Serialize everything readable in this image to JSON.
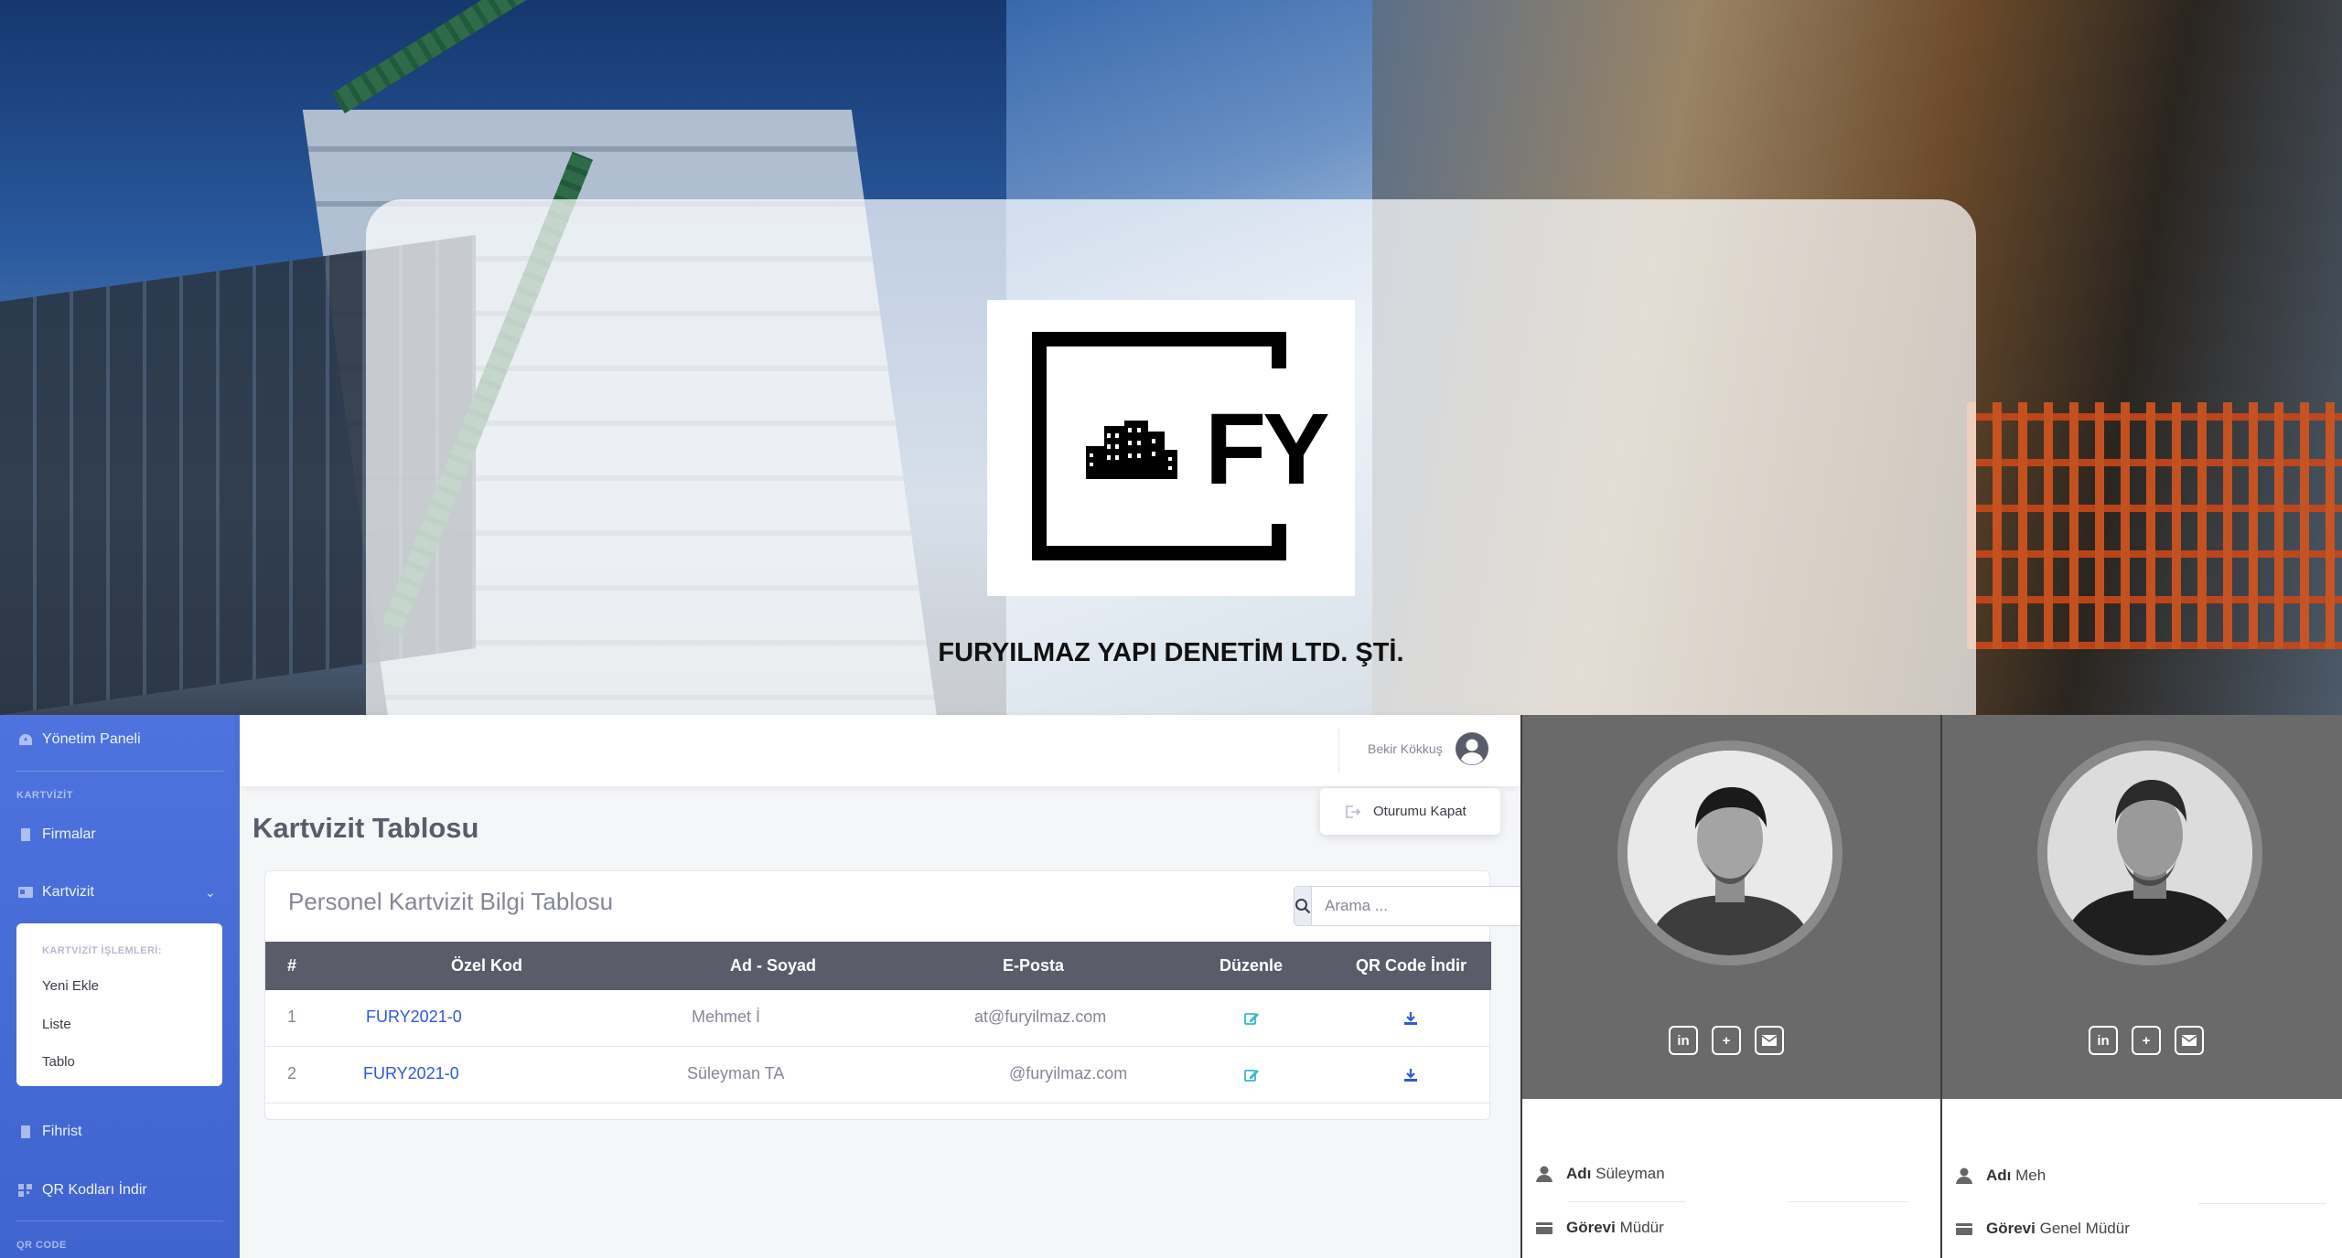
{
  "hero": {
    "logo_text": "FY",
    "company_name": "FURYILMAZ YAPI DENETİM LTD. ŞTİ."
  },
  "sidebar": {
    "dashboard": "Yönetim Paneli",
    "section_kartvizit": "KARTVİZİT",
    "firmalar": "Firmalar",
    "kartvizit": "Kartvizit",
    "submenu": {
      "header": "KARTVİZİT İŞLEMLERİ:",
      "items": [
        "Yeni Ekle",
        "Liste",
        "Tablo"
      ]
    },
    "fihrist": "Fihrist",
    "qr_download": "QR Kodları İndir",
    "section_qr": "QR CODE"
  },
  "topbar": {
    "user_name": "Bekir Kökkuş",
    "logout_label": "Oturumu Kapat"
  },
  "page": {
    "title": "Kartvizit Tablosu"
  },
  "table_card": {
    "title": "Personel Kartvizit Bilgi Tablosu",
    "search_placeholder": "Arama ...",
    "columns": [
      "#",
      "Özel Kod",
      "Ad - Soyad",
      "E-Posta",
      "Düzenle",
      "QR Code İndir"
    ],
    "rows": [
      {
        "index": "1",
        "code": "FURY2021-0",
        "name": "Mehmet İ",
        "email": "at@furyilmaz.com"
      },
      {
        "index": "2",
        "code": "FURY2021-0",
        "name": "Süleyman TA",
        "email": "@furyilmaz.com"
      }
    ]
  },
  "profiles": [
    {
      "name_label": "Adı",
      "name_value": "Süleyman ",
      "role_label": "Görevi",
      "role_value": "Müdür"
    },
    {
      "name_label": "Adı",
      "name_value": "Meh",
      "role_label": "Görevi",
      "role_value": "Genel Müdür"
    }
  ],
  "social": {
    "linkedin": "in",
    "add": "+"
  },
  "colors": {
    "sidebar": "#4e73df",
    "table_header": "#5a5c69",
    "link": "#2e59d9",
    "edit_icon": "#36b9cc",
    "download_icon": "#2e59d9",
    "profile_band": "#6a6a6a"
  }
}
